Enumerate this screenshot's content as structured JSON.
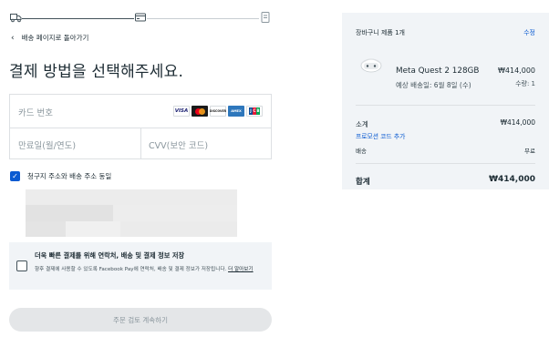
{
  "checkout": {
    "back_label": "배송 페이지로 돌아가기",
    "title": "결제 방법을 선택해주세요.",
    "card": {
      "number_placeholder": "카드 번호",
      "expiry_placeholder": "만료일(월/연도)",
      "cvv_placeholder": "CVV(보안 코드)",
      "brands": {
        "visa": "VISA",
        "discover": "DISCOVER",
        "amex": "AMEX"
      }
    },
    "same_address_label": "청구지 주소와 배송 주소 동일",
    "save_info": {
      "title": "더욱 빠른 결제를 위해 연락처, 배송 및 결제 정보 저장",
      "description": "향후 결제에 사용할 수 있도록 Facebook Pay에 연락처, 배송 및 결제 정보가 저장됩니다.",
      "link": "더 알아보기"
    },
    "continue_label": "주문 검토 계속하기"
  },
  "summary": {
    "header": "장바구니 제품 1개",
    "edit_label": "수정",
    "product": {
      "name": "Meta Quest 2 128GB",
      "delivery": "예상 배송일: 6월 8일 (수)",
      "price": "₩414,000",
      "quantity": "수량: 1"
    },
    "subtotal_label": "소계",
    "subtotal_value": "₩414,000",
    "promo_label": "프로모션 코드 추가",
    "shipping_label": "배송",
    "shipping_value": "무료",
    "total_label": "합계",
    "total_value": "₩414,000"
  },
  "colors": {
    "accent": "#0a5ad1",
    "panel": "#f1f4f7",
    "text": "#1c2b33"
  }
}
